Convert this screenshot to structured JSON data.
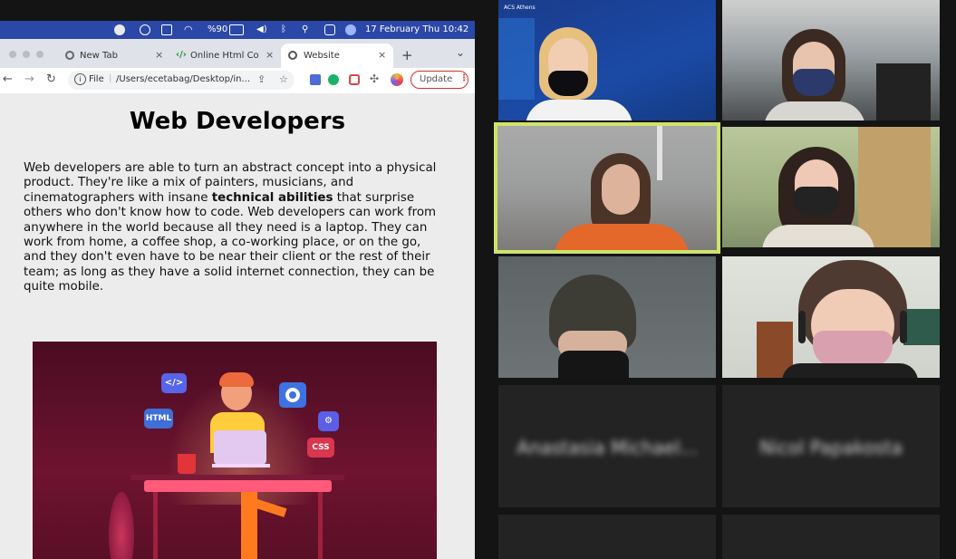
{
  "menubar": {
    "battery": "%90",
    "clock": "17 February Thu  10:42"
  },
  "browser": {
    "tabs": [
      {
        "label": "New Tab",
        "close": "×"
      },
      {
        "label": "Online Html Comp",
        "close": "×"
      },
      {
        "label": "Website",
        "close": "×"
      }
    ],
    "new_tab": "+",
    "tab_menu": "⌄",
    "address": {
      "scheme": "File",
      "path": "/Users/ecetabag/Desktop/in..."
    },
    "update_label": "Update"
  },
  "page": {
    "title": "Web Developers",
    "paragraph_before": "Web developers are able to turn an abstract concept into a physical product. They're like a mix of painters, musicians, and cinematographers with insane ",
    "paragraph_bold": "technical abilities",
    "paragraph_after": " that surprise others who don't know how to code. Web developers can work from anywhere in the world because all they need is a laptop. They can work from home, a coffee shop, a co-working place, or on the go, and they don't even have to be near their client or the rest of their team; as long as they have a solid internet connection, they can be quite mobile.",
    "illustration": {
      "code_tag": "</>",
      "html_tag": "HTML",
      "css_tag": "CSS"
    }
  },
  "meeting": {
    "header_logo_text": "ACS Athens",
    "participants": [
      {
        "name": "Anastasia Michael..."
      },
      {
        "name": "Nicol Papakosta"
      }
    ]
  },
  "colors": {
    "active_speaker_border": "#cde36a",
    "menubar": "#2b48a8",
    "update_border": "#d93025"
  }
}
